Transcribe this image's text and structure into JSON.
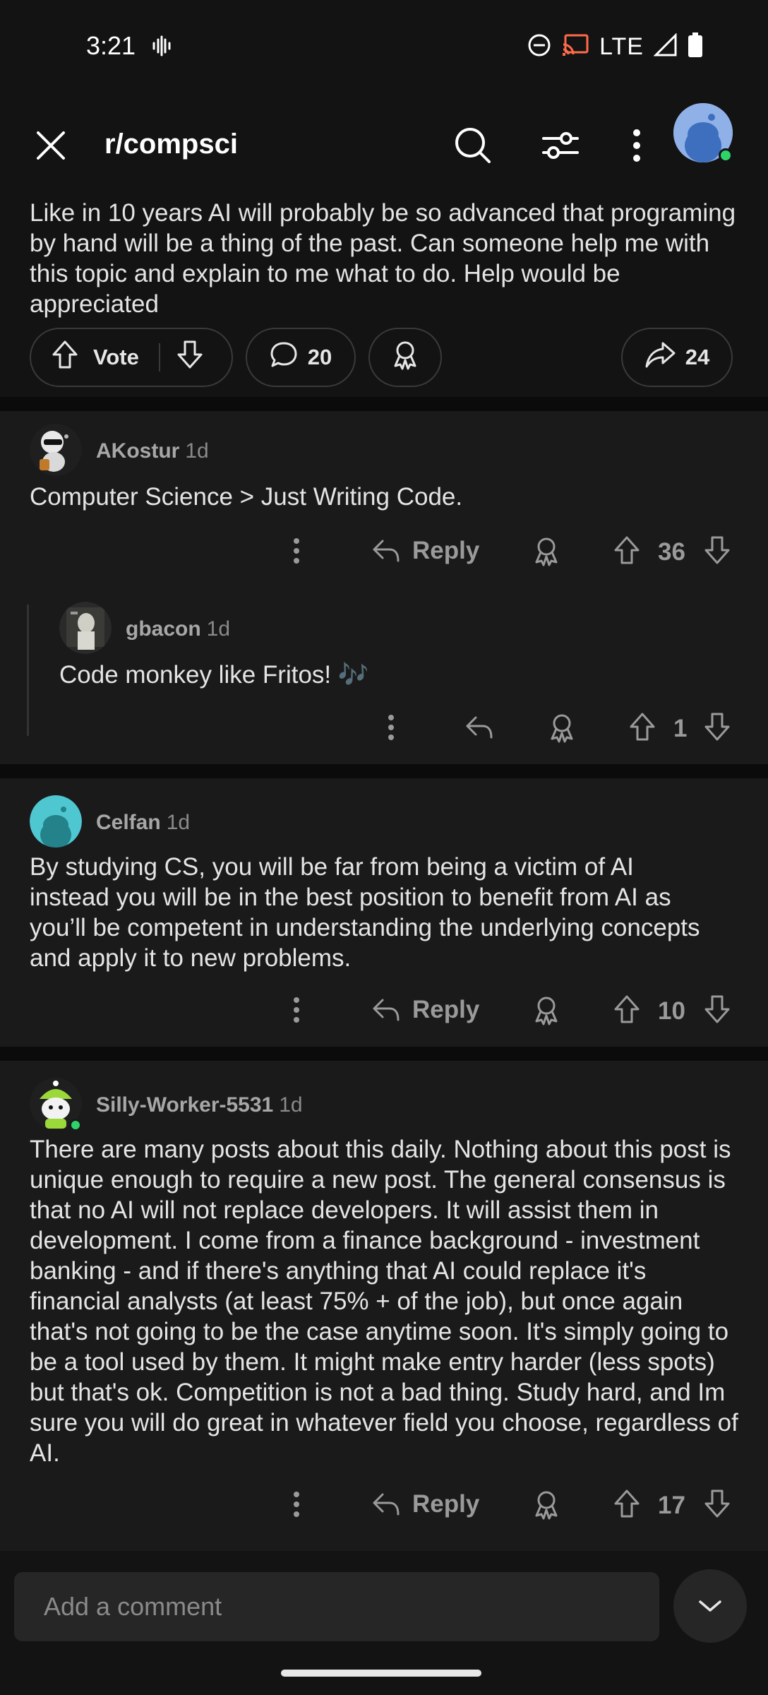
{
  "status_bar": {
    "time": "3:21",
    "network": "LTE"
  },
  "header": {
    "subreddit": "r/compsci"
  },
  "post": {
    "body": "Like in 10 years AI will probably be so advanced that programing by hand will be a thing of the past. Can someone help me with this topic and explain to me what to do. Help would be appreciated",
    "vote_label": "Vote",
    "comment_count": "20",
    "share_count": "24"
  },
  "comments": [
    {
      "user": "AKostur",
      "age": "1d",
      "text": "Computer Science > Just Writing Code.",
      "reply_label": "Reply",
      "score": "36"
    },
    {
      "user": "gbacon",
      "age": "1d",
      "text": "Code monkey like Fritos! 🎶",
      "score": "1"
    },
    {
      "user": "Celfan",
      "age": "1d",
      "text": "By studying CS, you will be far from being a victim of AI instead you will be in the best position to benefit from AI as you’ll be competent in understanding the underlying concepts and apply it to new problems.",
      "reply_label": "Reply",
      "score": "10"
    },
    {
      "user": "Silly-Worker-5531",
      "age": "1d",
      "text": "There are many posts about this daily. Nothing about this post is unique enough to require a new post. The general consensus is that no AI will not replace developers. It will assist them in development. I come from a finance background - investment banking - and if there's anything that AI could replace it's financial analysts (at least 75% + of the job), but once again that's not going to be the case anytime soon. It's simply going to be a tool used by them. It might make entry harder (less spots) but that's ok. Competition is not a bad thing. Study hard, and Im sure you will do great in whatever field you choose, regardless of AI.",
      "reply_label": "Reply",
      "score": "17"
    }
  ],
  "bottom": {
    "comment_placeholder": "Add a comment"
  },
  "colors": {
    "background": "#131313",
    "comment_bg": "#1a1a1b",
    "online": "#2fd36a",
    "avatar_blue": "#8fb1e8",
    "avatar_teal": "#4fc7d1"
  }
}
